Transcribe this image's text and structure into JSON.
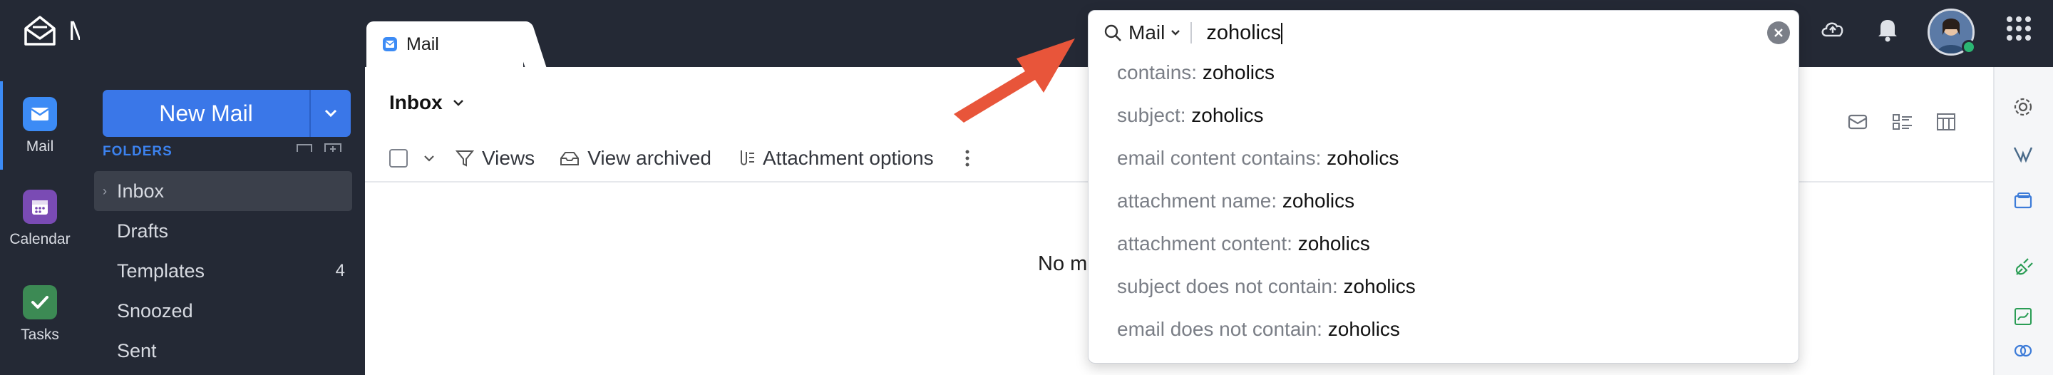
{
  "app": {
    "name": "Mail"
  },
  "rail": {
    "items": [
      {
        "label": "Mail",
        "color": "#3c8bf5"
      },
      {
        "label": "Calendar",
        "color": "#7a4bb4"
      },
      {
        "label": "Tasks",
        "color": "#3c8a54"
      }
    ]
  },
  "new_mail": {
    "label": "New Mail"
  },
  "folders": {
    "heading": "FOLDERS",
    "items": [
      {
        "label": "Inbox",
        "count": ""
      },
      {
        "label": "Drafts",
        "count": ""
      },
      {
        "label": "Templates",
        "count": "4"
      },
      {
        "label": "Snoozed",
        "count": ""
      },
      {
        "label": "Sent",
        "count": ""
      }
    ]
  },
  "tab": {
    "label": "Mail"
  },
  "main": {
    "title": "Inbox",
    "toolbar": {
      "views": "Views",
      "view_archived": "View archived",
      "attachment_options": "Attachment options"
    },
    "empty_text": "No m"
  },
  "search": {
    "scope": "Mail",
    "query": "zoholics",
    "suggestions": [
      {
        "key": "contains:",
        "value": "zoholics"
      },
      {
        "key": "subject:",
        "value": "zoholics"
      },
      {
        "key": "email content contains:",
        "value": "zoholics"
      },
      {
        "key": "attachment name:",
        "value": "zoholics"
      },
      {
        "key": "attachment content:",
        "value": "zoholics"
      },
      {
        "key": "subject does not contain:",
        "value": "zoholics"
      },
      {
        "key": "email does not contain:",
        "value": "zoholics"
      }
    ]
  },
  "colors": {
    "accent": "#3a77e8",
    "annotation_arrow": "#e8553a",
    "status_online": "#2bb673"
  }
}
